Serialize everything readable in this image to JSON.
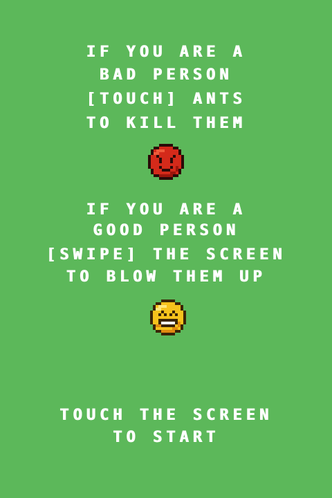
{
  "bad_section": {
    "lines": [
      "IF YOU ARE A",
      "BAD PERSON",
      "[TOUCH] ANTS",
      "TO KILL THEM"
    ],
    "face_icon": "angry-red-face-icon",
    "face_color": "#d42a1a"
  },
  "good_section": {
    "lines": [
      "IF YOU ARE A",
      "GOOD PERSON",
      "[SWIPE] THE SCREEN",
      "TO BLOW THEM UP"
    ],
    "face_icon": "laughing-yellow-face-icon",
    "face_color": "#f7c21c"
  },
  "start_prompt": {
    "lines": [
      "TOUCH THE SCREEN",
      "TO START"
    ]
  },
  "colors": {
    "background": "#5cb85a",
    "text": "#ffffff"
  }
}
